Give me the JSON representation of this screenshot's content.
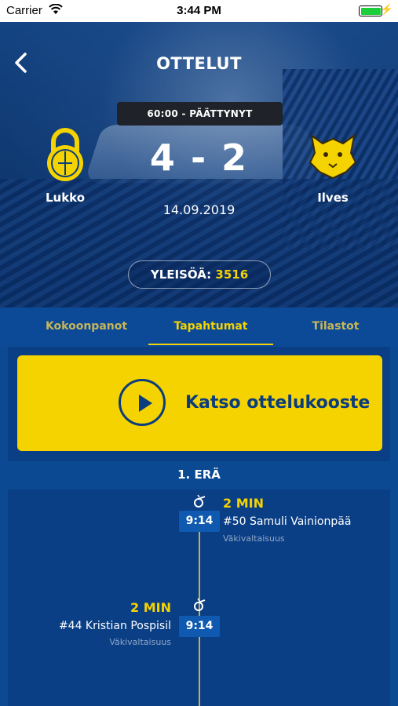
{
  "status_bar": {
    "carrier": "Carrier",
    "time": "3:44 PM"
  },
  "header": {
    "title": "OTTELUT"
  },
  "match": {
    "period_status": "60:00 - PÄÄTTYNYT",
    "score": "4 - 2",
    "date": "14.09.2019",
    "home_team": "Lukko",
    "away_team": "Ilves",
    "attendance_label": "YLEISÖÄ:",
    "attendance_value": "3516"
  },
  "tabs": [
    {
      "label": "Kokoonpanot",
      "active": false
    },
    {
      "label": "Tapahtumat",
      "active": true
    },
    {
      "label": "Tilastot",
      "active": false
    }
  ],
  "highlight": {
    "label": "Katso ottelukooste"
  },
  "period": {
    "title": "1. ERÄ"
  },
  "events": [
    {
      "time": "9:14",
      "penalty": "2 MIN",
      "player": "#50 Samuli Vainionpää",
      "type": "Väkivaltaisuus",
      "side": "right"
    },
    {
      "time": "9:14",
      "penalty": "2 MIN",
      "player": "#44 Kristian Pospisil",
      "type": "Väkivaltaisuus",
      "side": "left"
    }
  ],
  "colors": {
    "accent": "#f5d300",
    "background": "#0b4a93",
    "card": "#0a3f85"
  }
}
